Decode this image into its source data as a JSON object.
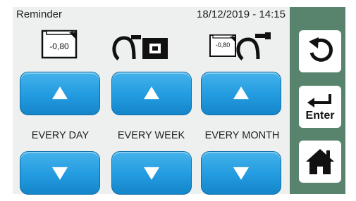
{
  "header": {
    "title": "Reminder",
    "datetime": "18/12/2019 - 14:15"
  },
  "columns": [
    {
      "label": "EVERY DAY",
      "icon": "battery-panel-icon",
      "icon_text": "-0,80"
    },
    {
      "label": "EVERY WEEK",
      "icon": "cable-connector-icon"
    },
    {
      "label": "EVERY MONTH",
      "icon": "battery-panel-cable-icon",
      "icon_text": "-0,80"
    }
  ],
  "side": {
    "back_icon": "undo-arrow-icon",
    "enter_label": "Enter",
    "enter_icon": "return-arrow-icon",
    "home_icon": "home-icon"
  },
  "colors": {
    "button_blue": "#239be0",
    "side_green": "#58836c",
    "panel_bg": "#eef0ef"
  }
}
